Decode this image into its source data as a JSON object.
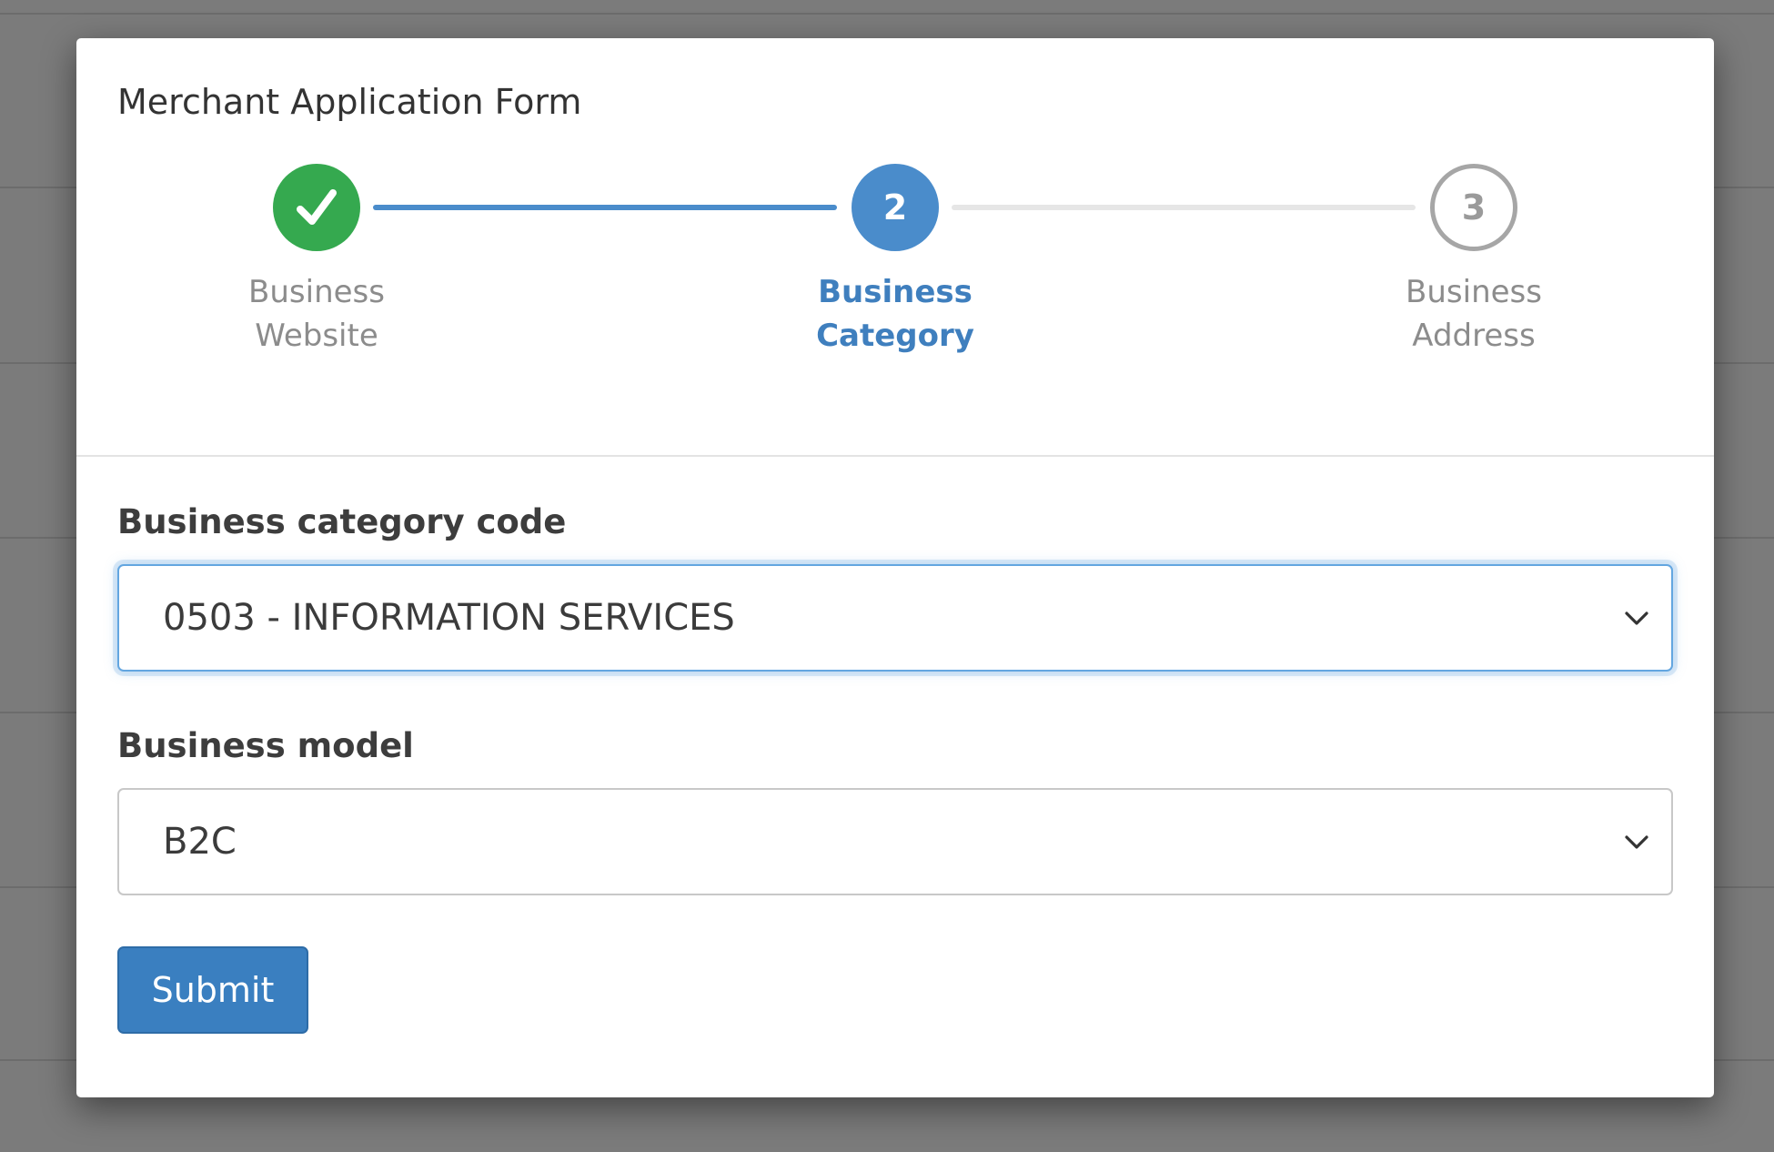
{
  "modal": {
    "title": "Merchant Application Form"
  },
  "stepper": {
    "steps": [
      {
        "number": "1",
        "label_line1": "Business",
        "label_line2": "Website",
        "state": "complete",
        "icon": "check-icon"
      },
      {
        "number": "2",
        "label_line1": "Business",
        "label_line2": "Category",
        "state": "active"
      },
      {
        "number": "3",
        "label_line1": "Business",
        "label_line2": "Address",
        "state": "pending"
      }
    ]
  },
  "form": {
    "category": {
      "label": "Business category code",
      "selected": "0503 - INFORMATION SERVICES",
      "state": "focused"
    },
    "model": {
      "label": "Business model",
      "selected": "B2C"
    },
    "submit_label": "Submit"
  },
  "colors": {
    "complete": "#35a94f",
    "active": "#4a8ccb",
    "active_text": "#3f7fbe",
    "pending": "#a6a6a6",
    "inactive_text": "#8c8c8c",
    "connector_inactive": "#e6e6e6",
    "button": "#3a7fc0",
    "focus_ring": "#63a6e0"
  }
}
